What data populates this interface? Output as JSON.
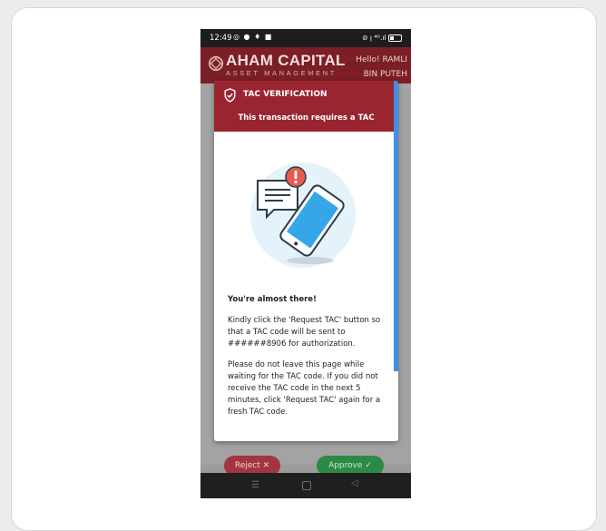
{
  "status_bar": {
    "time": "12:49",
    "left_icons": [
      "whatsapp-icon",
      "message-icon",
      "notification-icon",
      "gallery-icon"
    ],
    "right_icons_text": "⊘ ꞁ ⁴ᴳ.ıl"
  },
  "app_bar": {
    "brand_name": "AHAM CAPITAL",
    "brand_tagline": "ASSET MANAGEMENT",
    "greeting_line1": "Hello! RAMLI",
    "greeting_line2": "BIN PUTEH"
  },
  "modal": {
    "title": "TAC VERIFICATION",
    "subtitle": "This transaction requires a TAC",
    "heading": "You're almost there!",
    "paragraph1": "Kindly click the 'Request TAC' button so that a TAC code will be sent to ######8906 for authorization.",
    "paragraph2": "Please do not leave this page while waiting for the TAC code. If you did not receive the TAC code in the next 5 minutes, click 'Request TAC' again for a fresh TAC code."
  },
  "actions": {
    "reject_label": "Reject ✕",
    "approve_label": "Approve ✓"
  },
  "colors": {
    "brand": "#7b1e25",
    "modal_header": "#9a2530",
    "accent_scroll": "#3f8fe4",
    "approve": "#2d8a45",
    "reject": "#a2353e"
  }
}
